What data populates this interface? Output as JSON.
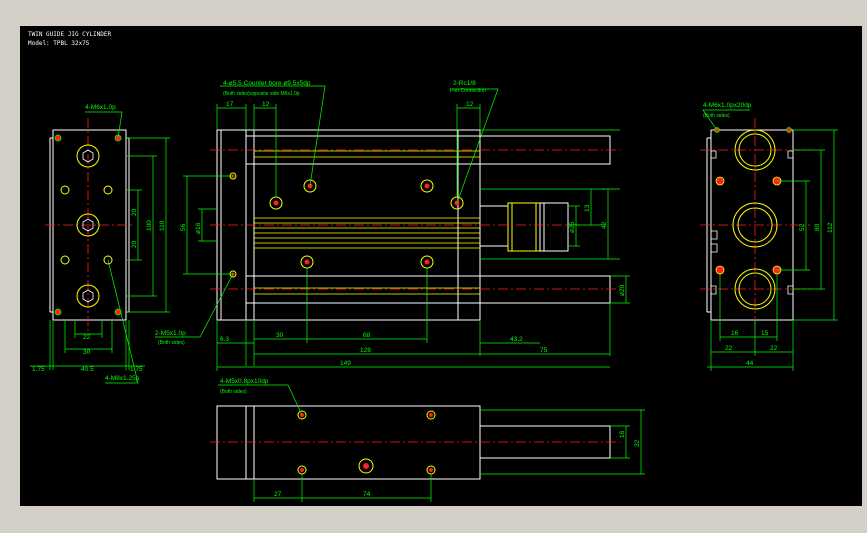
{
  "title": {
    "line1": "TWIN GUIDE JIG CYLINDER",
    "line2": "Model: TPBL 32x75"
  },
  "colors": {
    "outline": "#ffffff",
    "dimension": "#00ff00",
    "hidden": "#ffff00",
    "center": "#ff2020",
    "background": "#000000",
    "frame": "#d4d0c8"
  },
  "notes": {
    "left_view_holes": "4-M6x1.0p",
    "left_view_bottom": "4-M8x1.25p",
    "counter_bore": "4-ø5.5  Counter bore ø9.5x5dp",
    "counter_bore_sub": "(Both sides)opposite side M6x1.0p",
    "port": "2-Rc1/8",
    "port_sub": "Port Connection",
    "side_holes": "2-M5x1.0p",
    "side_holes_sub": "(Both sides)",
    "right_view_holes": "4-M6x1.0px20dp",
    "right_view_sub": "(Both sides)",
    "bottom_view_holes": "4-M5x0.8px10dp",
    "bottom_view_sub": "(Both sides)"
  },
  "dims": {
    "left": {
      "d20a": "20",
      "d20b": "20",
      "d100": "100",
      "d110": "110",
      "d22": "22",
      "d30": "30",
      "d40_5": "40.5",
      "d1_75a": "1.75",
      "d1_75b": "1.75"
    },
    "front": {
      "d17": "17",
      "d12a": "12",
      "d12b": "12",
      "d56": "56",
      "d16": "ø16",
      "d25": "ø25",
      "d13": "13",
      "d42": "42",
      "d20": "ø20",
      "d6_3": "6.3",
      "d30": "30",
      "d68": "68",
      "d43_2": "43.2",
      "d128": "128",
      "d75": "75",
      "d149": "149"
    },
    "right": {
      "d52": "52",
      "d80": "80",
      "d112": "112",
      "d16": "16",
      "d15": "15",
      "d22a": "22",
      "d22b": "22",
      "d44": "44"
    },
    "bottom": {
      "d16": "16",
      "d32": "32",
      "d27": "27",
      "d74": "74"
    }
  }
}
